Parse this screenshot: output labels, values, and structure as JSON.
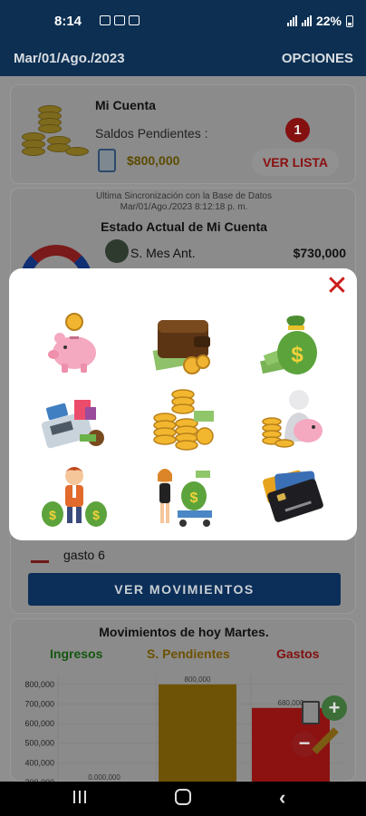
{
  "status_bar": {
    "time": "8:14",
    "battery": "22%"
  },
  "app_bar": {
    "date": "Mar/01/Ago./2023",
    "options": "OPCIONES"
  },
  "account": {
    "title": "Mi Cuenta",
    "pending_label": "Saldos Pendientes :",
    "pending_amount": "$800,000",
    "badge_count": "1",
    "list_button": "VER LISTA"
  },
  "status": {
    "sync_line1": "Ultima Sincronización con la Base de Datos",
    "sync_line2": "Mar/01/Ago./2023   8:12:18 p. m.",
    "title": "Estado Actual de Mi Cuenta",
    "prev_month_label": "S. Mes Ant.",
    "prev_month_value": "$730,000",
    "expense_item": "gasto 6",
    "movements_button": "VER MOVIMIENTOS"
  },
  "modal": {
    "items": [
      {
        "icon": "piggy-bank-icon"
      },
      {
        "icon": "wallet-icon"
      },
      {
        "icon": "money-bag-icon"
      },
      {
        "icon": "cash-register-icon"
      },
      {
        "icon": "coin-stacks-icon"
      },
      {
        "icon": "savings-person-icon"
      },
      {
        "icon": "businessman-money-bags-icon"
      },
      {
        "icon": "woman-money-cart-icon"
      },
      {
        "icon": "credit-cards-icon"
      }
    ]
  },
  "chart_data": {
    "type": "bar",
    "title": "Movimientos de hoy Martes.",
    "categories": [
      "Ingresos",
      "S. Pendientes",
      "Gastos"
    ],
    "values": [
      0,
      800000,
      680000
    ],
    "data_labels": [
      "0.000,000",
      "800,000",
      "680,000"
    ],
    "y_ticks": [
      "800,000",
      "700,000",
      "600,000",
      "500,000",
      "400,000",
      "300,000"
    ],
    "ylim": [
      300000,
      850000
    ],
    "colors": {
      "Ingresos": "#1f8a14",
      "S. Pendientes": "#a57a0c",
      "Gastos": "#d11a1a"
    }
  }
}
